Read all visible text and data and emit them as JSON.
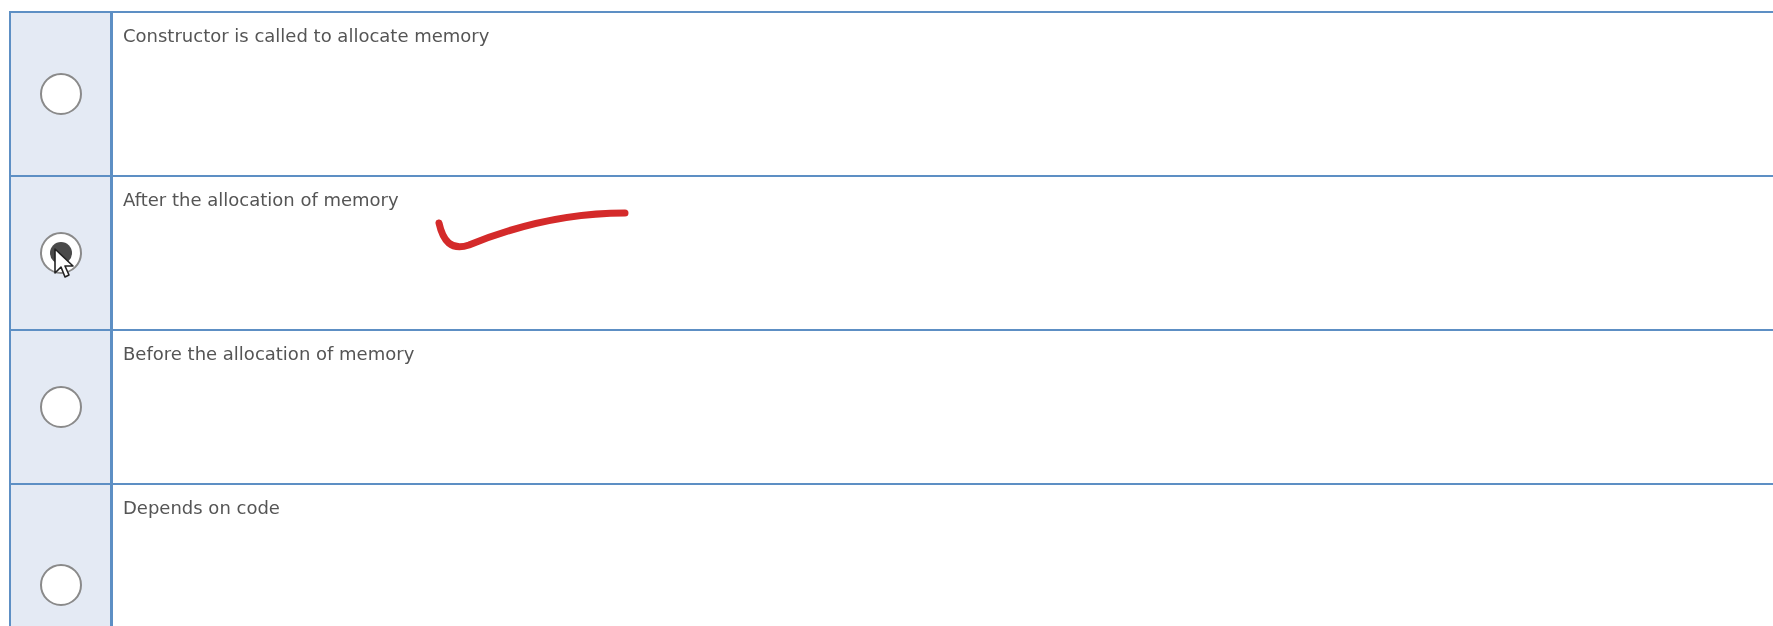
{
  "options": [
    {
      "label": "Constructor is called to allocate memory",
      "selected": false,
      "annotated": false,
      "cursor": false
    },
    {
      "label": "After the allocation of memory",
      "selected": true,
      "annotated": true,
      "cursor": true
    },
    {
      "label": "Before the allocation of memory",
      "selected": false,
      "annotated": false,
      "cursor": false
    },
    {
      "label": "Depends on code",
      "selected": false,
      "annotated": false,
      "cursor": false
    }
  ]
}
